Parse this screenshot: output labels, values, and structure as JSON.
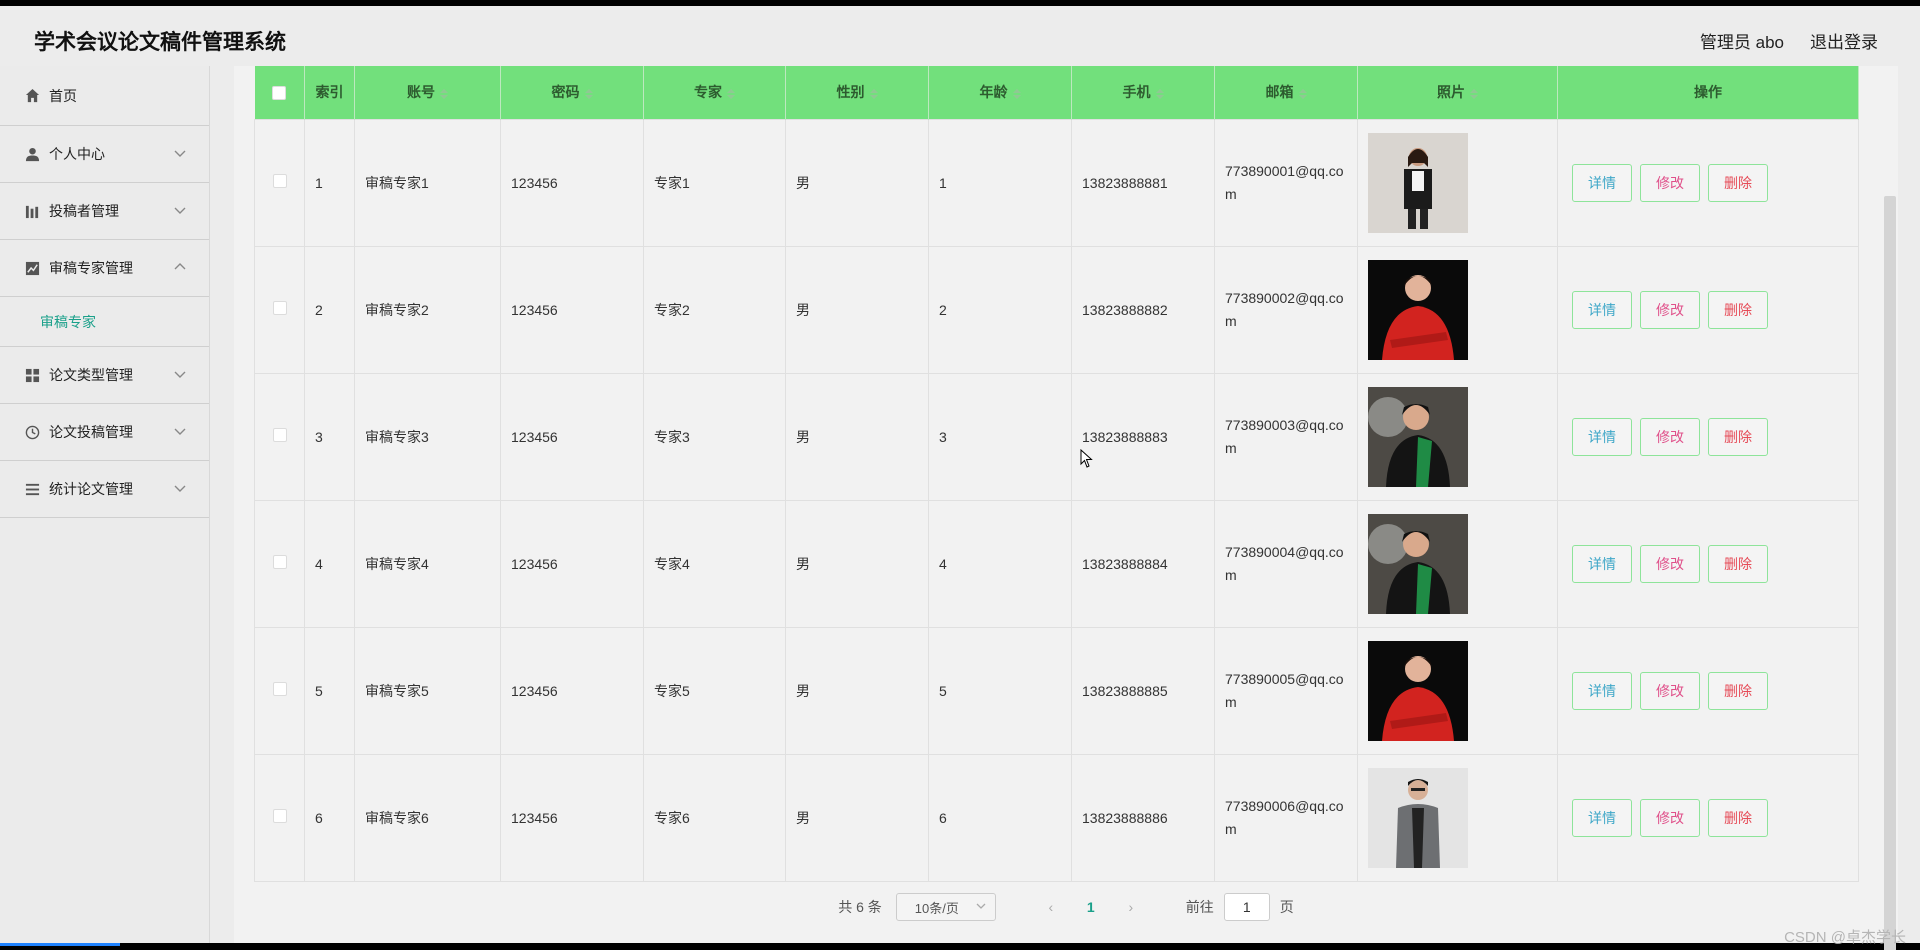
{
  "app": {
    "title": "学术会议论文稿件管理系统"
  },
  "header": {
    "user": "管理员 abo",
    "logout": "退出登录"
  },
  "sidebar": {
    "items": [
      {
        "label": "首页",
        "icon": "home-icon"
      },
      {
        "label": "个人中心",
        "icon": "person-icon"
      },
      {
        "label": "投稿者管理",
        "icon": "bar-chart-icon"
      },
      {
        "label": "审稿专家管理",
        "icon": "trend-icon",
        "expanded": true
      },
      {
        "label": "论文类型管理",
        "icon": "grid-icon"
      },
      {
        "label": "论文投稿管理",
        "icon": "clock-icon"
      },
      {
        "label": "统计论文管理",
        "icon": "list-icon"
      }
    ],
    "submenu": {
      "label": "审稿专家"
    }
  },
  "table": {
    "headers": [
      "索引",
      "账号",
      "密码",
      "专家",
      "性别",
      "年龄",
      "手机",
      "邮箱",
      "照片",
      "操作"
    ],
    "rows": [
      {
        "index": "1",
        "account": "审稿专家1",
        "password": "123456",
        "expert": "专家1",
        "gender": "男",
        "age": "1",
        "phone": "13823888881",
        "email": "773890001@qq.com",
        "photo": "woman-black-jacket"
      },
      {
        "index": "2",
        "account": "审稿专家2",
        "password": "123456",
        "expert": "专家2",
        "gender": "男",
        "age": "2",
        "phone": "13823888882",
        "email": "773890002@qq.com",
        "photo": "woman-red-shirt"
      },
      {
        "index": "3",
        "account": "审稿专家3",
        "password": "123456",
        "expert": "专家3",
        "gender": "男",
        "age": "3",
        "phone": "13823888883",
        "email": "773890003@qq.com",
        "photo": "woman-green-black"
      },
      {
        "index": "4",
        "account": "审稿专家4",
        "password": "123456",
        "expert": "专家4",
        "gender": "男",
        "age": "4",
        "phone": "13823888884",
        "email": "773890004@qq.com",
        "photo": "woman-green-black"
      },
      {
        "index": "5",
        "account": "审稿专家5",
        "password": "123456",
        "expert": "专家5",
        "gender": "男",
        "age": "5",
        "phone": "13823888885",
        "email": "773890005@qq.com",
        "photo": "woman-red-shirt"
      },
      {
        "index": "6",
        "account": "审稿专家6",
        "password": "123456",
        "expert": "专家6",
        "gender": "男",
        "age": "6",
        "phone": "13823888886",
        "email": "773890006@qq.com",
        "photo": "man-grey-jacket"
      }
    ],
    "actions": {
      "detail": "详情",
      "edit": "修改",
      "delete": "删除"
    }
  },
  "pagination": {
    "total": "共 6 条",
    "page_size": "10条/页",
    "current": "1",
    "goto_prefix": "前往",
    "goto_value": "1",
    "goto_suffix": "页"
  },
  "watermark": "CSDN @卓杰学长",
  "colors": {
    "header_green": "#72e07c",
    "accent_teal": "#1aa08a",
    "edit_pink": "#e0508a",
    "delete_red": "#e64b57",
    "detail_blue": "#3fa7c8"
  }
}
